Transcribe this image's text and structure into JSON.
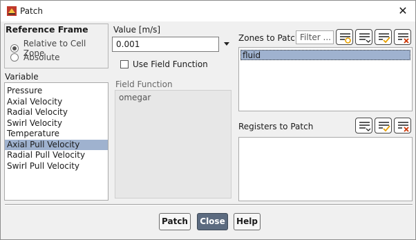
{
  "window": {
    "title": "Patch"
  },
  "reference_frame": {
    "heading": "Reference Frame",
    "options": [
      {
        "label": "Relative to Cell Zone",
        "selected": true
      },
      {
        "label": "Absolute",
        "selected": false
      }
    ]
  },
  "variable": {
    "heading": "Variable",
    "items": [
      "Pressure",
      "Axial Velocity",
      "Radial Velocity",
      "Swirl Velocity",
      "Temperature",
      "Axial Pull Velocity",
      "Radial Pull Velocity",
      "Swirl Pull Velocity"
    ],
    "selected": "Axial Pull Velocity"
  },
  "value": {
    "label": "Value [m/s]",
    "current": "0.001"
  },
  "use_field_function": {
    "label": "Use Field Function",
    "checked": false
  },
  "field_function": {
    "label": "Field Function",
    "items": [
      "omegar"
    ]
  },
  "zones": {
    "label": "Zones to Patch",
    "filter_placeholder": "Filter ...",
    "items": [
      "fluid"
    ],
    "selected": "fluid"
  },
  "registers": {
    "label": "Registers to Patch",
    "items": []
  },
  "buttons": {
    "patch": "Patch",
    "close": "Close",
    "help": "Help"
  },
  "colors": {
    "selection": "#9fb2cf",
    "accent_check": "#e8a100",
    "accent_close": "#cc3300",
    "primary_button": "#5c6b80"
  },
  "icons": [
    "fluent-app-icon",
    "close-icon",
    "select-all-icon",
    "dropdown-list-icon",
    "check-list-icon",
    "clear-list-icon",
    "radio-icon",
    "checkbox-icon",
    "dropdown-arrow-icon"
  ]
}
